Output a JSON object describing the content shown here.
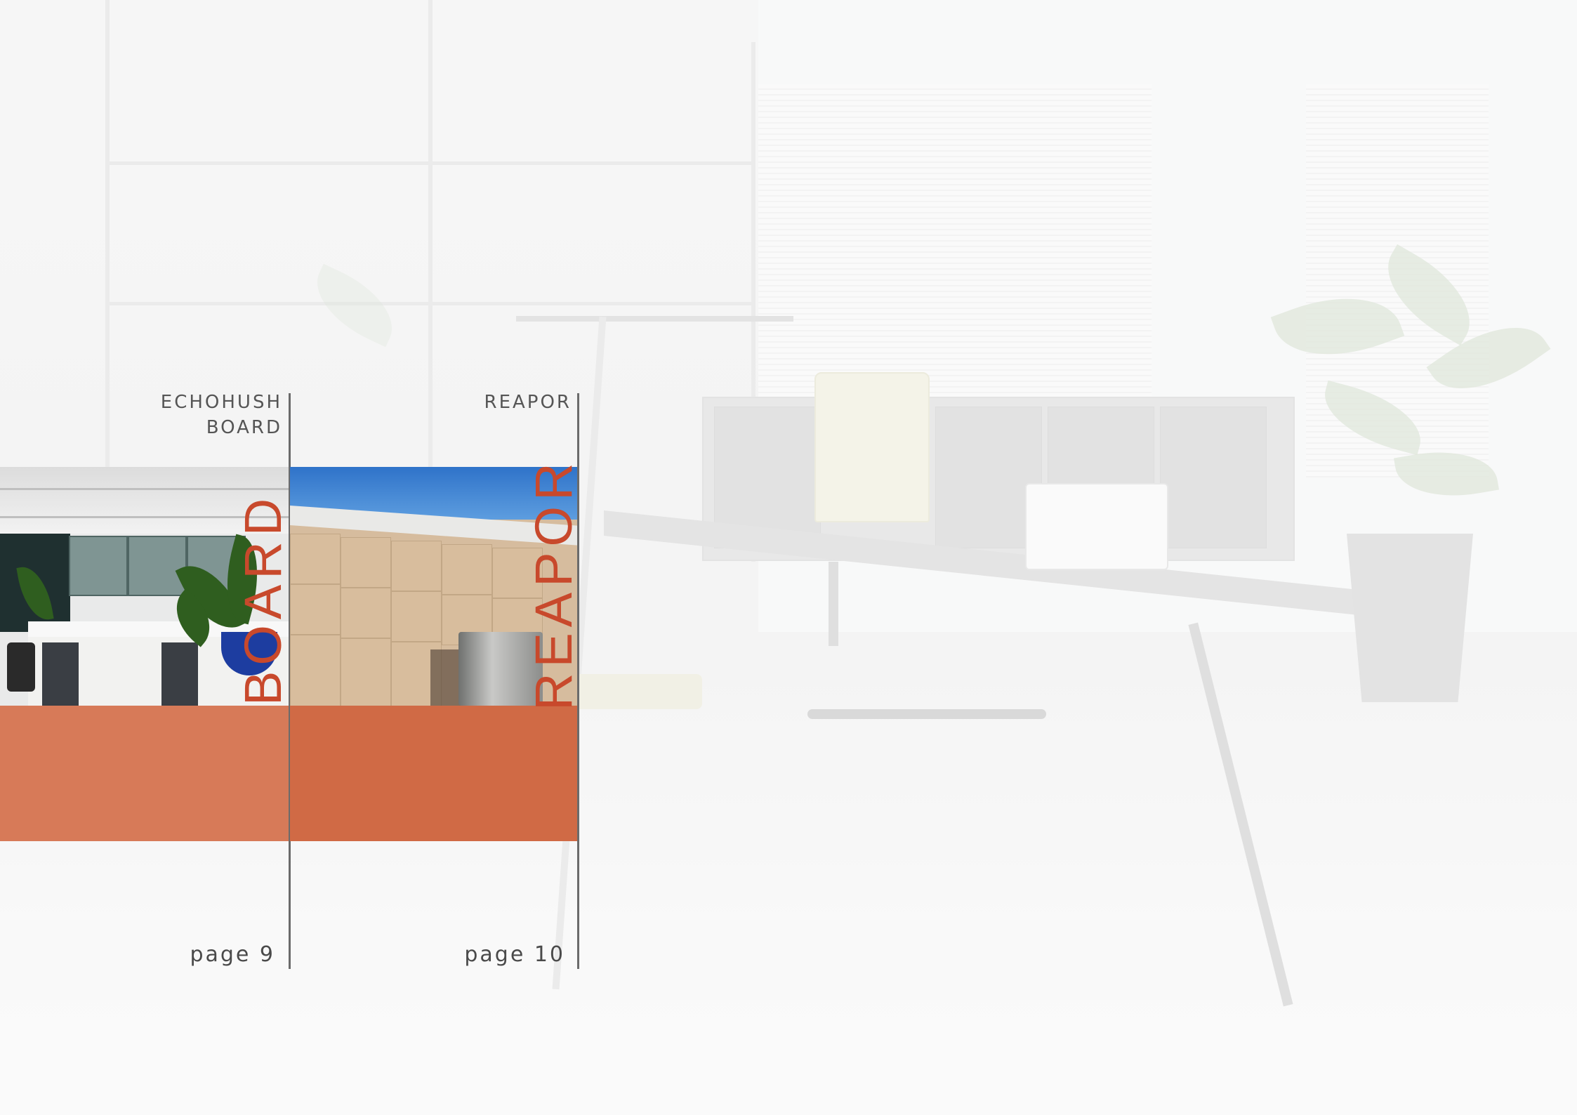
{
  "panels": [
    {
      "title_lines": [
        "ECHOHUSH",
        "BOARD"
      ],
      "vertical_word": "BOARD",
      "page_label": "page 9"
    },
    {
      "title_lines": [
        "REAPOR"
      ],
      "vertical_word": "REAPOR",
      "page_label": "page 10"
    }
  ],
  "colors": {
    "accent_text": "#c8492c",
    "block_1": "#d77a58",
    "block_2": "#d06a45",
    "divider": "#6b6b6b"
  }
}
